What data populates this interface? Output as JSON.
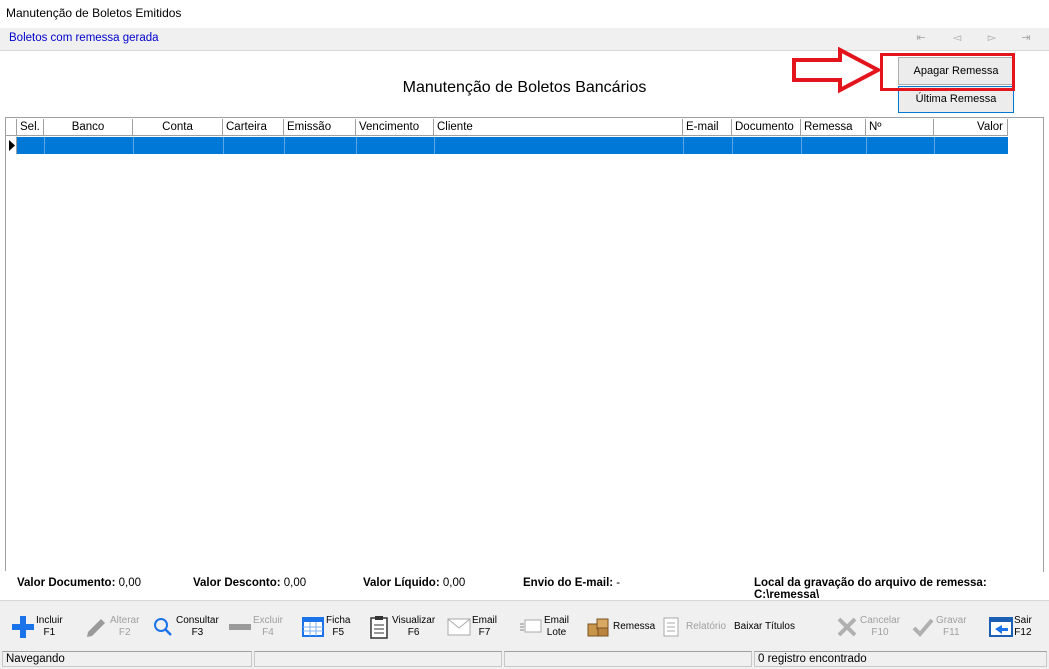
{
  "window": {
    "title": "Manutenção de Boletos Emitidos"
  },
  "subheader": {
    "text": "Boletos com remessa gerada"
  },
  "nav": {
    "first": "⇤",
    "prev": "◅",
    "next": "▻",
    "last": "⇥"
  },
  "panel": {
    "heading": "Manutenção de Boletos Bancários",
    "apagar_label": "Apagar Remessa",
    "ultima_label": "Última Remessa"
  },
  "grid": {
    "columns": [
      "Sel.",
      "Banco",
      "Conta",
      "Carteira",
      "Emissão",
      "Vencimento",
      "Cliente",
      "E-mail",
      "Documento",
      "Remessa",
      "Nº Remessa",
      "Valor"
    ]
  },
  "totals": {
    "valor_documento_label": "Valor Documento:",
    "valor_documento": "0,00",
    "valor_desconto_label": "Valor Desconto:",
    "valor_desconto": "0,00",
    "valor_liquido_label": "Valor Líquido:",
    "valor_liquido": "0,00",
    "envio_email_label": "Envio do E-mail:",
    "envio_email": "-",
    "local_label": "Local da gravação do arquivo de remessa:",
    "local": "C:\\remessa\\"
  },
  "toolbar": {
    "incluir": [
      "Incluir",
      "F1"
    ],
    "alterar": [
      "Alterar",
      "F2"
    ],
    "consultar": [
      "Consultar",
      "F3"
    ],
    "excluir": [
      "Excluir",
      "F4"
    ],
    "ficha": [
      "Ficha",
      "F5"
    ],
    "visualizar": [
      "Visualizar",
      "F6"
    ],
    "email": [
      "Email",
      "F7"
    ],
    "email_lote": [
      "Email",
      "Lote"
    ],
    "remessa": "Remessa",
    "relatorio": "Relatório",
    "baixar": "Baixar Títulos",
    "cancelar": [
      "Cancelar",
      "F10"
    ],
    "gravar": [
      "Gravar",
      "F11"
    ],
    "sair": [
      "Sair",
      "F12"
    ]
  },
  "status": {
    "mode": "Navegando",
    "records": "0 registro encontrado"
  },
  "colors": {
    "accent": "#0078d7",
    "highlight": "#e3141c",
    "link": "#0000cc"
  }
}
